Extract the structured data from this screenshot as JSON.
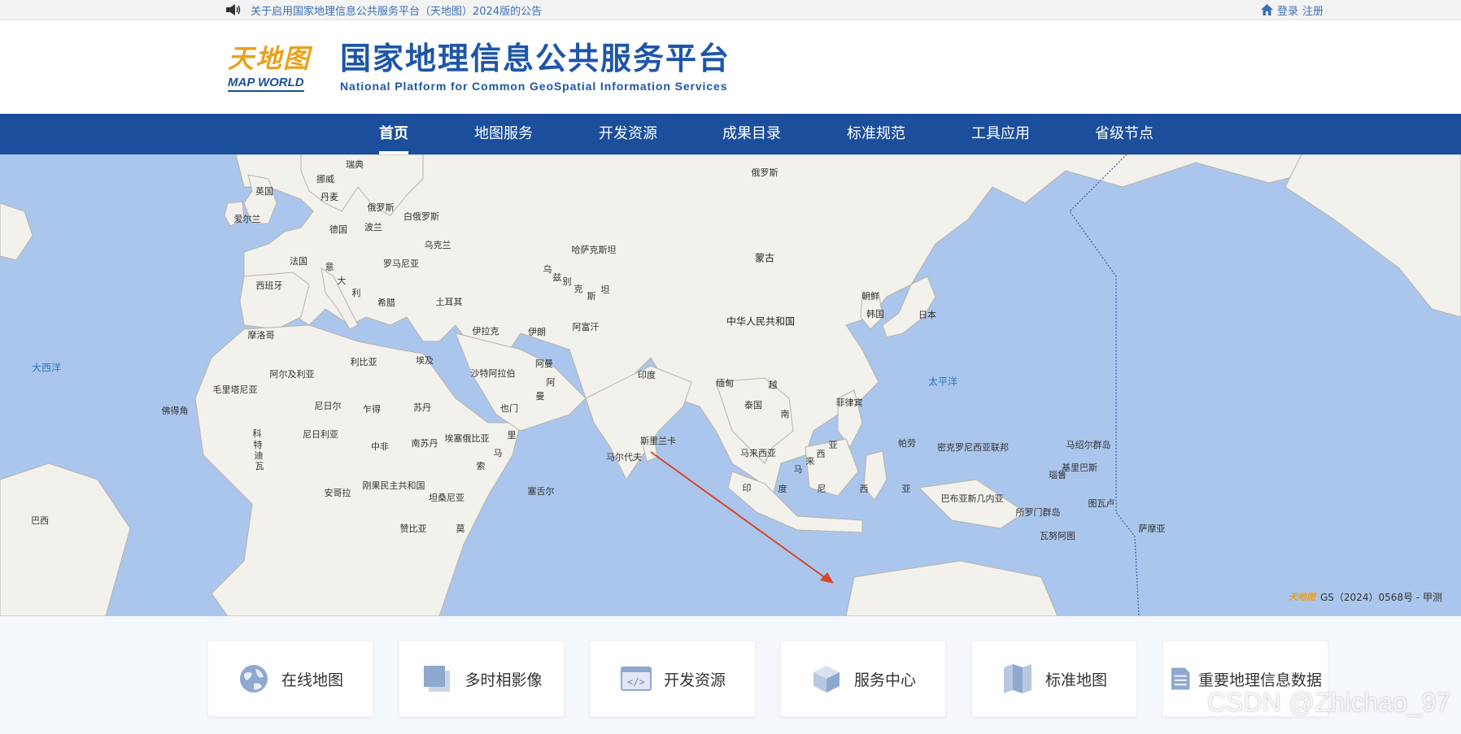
{
  "topbar": {
    "notice": "关于启用国家地理信息公共服务平台（天地图）2024版的公告",
    "login": "登录",
    "register": "注册"
  },
  "header": {
    "logo_cn": "天地图",
    "logo_en": "MAP WORLD",
    "title_cn": "国家地理信息公共服务平台",
    "title_en": "National Platform for Common GeoSpatial Information Services"
  },
  "nav": {
    "items": [
      {
        "label": "首页",
        "active": true
      },
      {
        "label": "地图服务"
      },
      {
        "label": "开发资源"
      },
      {
        "label": "成果目录"
      },
      {
        "label": "标准规范"
      },
      {
        "label": "工具应用"
      },
      {
        "label": "省级节点"
      }
    ]
  },
  "map": {
    "labels": {
      "sweden": "瑞典",
      "norway": "挪威",
      "uk": "英国",
      "denmark": "丹麦",
      "ireland": "爱尔兰",
      "russia_w": "俄罗斯",
      "belarus": "白俄罗斯",
      "germany": "德国",
      "poland": "波兰",
      "ukraine": "乌克兰",
      "france": "法国",
      "italy1": "意",
      "italy2": "大",
      "italy3": "利",
      "romania": "罗马尼亚",
      "spain": "西班牙",
      "greece": "希腊",
      "turkey": "土耳其",
      "russia": "俄罗斯",
      "kazakhstan": "哈萨克斯坦",
      "uzbek1": "乌",
      "uzbek2": "兹",
      "uzbek3": "别",
      "uzbek4": "克",
      "uzbek5": "斯",
      "uzbek6": "坦",
      "mongolia": "蒙古",
      "china": "中华人民共和国",
      "nkorea": "朝鲜",
      "skorea": "韩国",
      "japan": "日本",
      "morocco": "摩洛哥",
      "algeria": "阿尔及利亚",
      "libya": "利比亚",
      "egypt": "埃及",
      "iraq": "伊拉克",
      "iran": "伊朗",
      "afghanistan": "阿富汗",
      "saudi": "沙特阿拉伯",
      "oman1": "阿曼",
      "oman2": "阿",
      "oman3": "曼",
      "yemen": "也门",
      "india": "印度",
      "myanmar": "缅甸",
      "vietnam1": "越",
      "vietnam2": "南",
      "thailand": "泰国",
      "philippines": "菲律宾",
      "mauritania": "毛里塔尼亚",
      "mali": "马里",
      "niger": "尼日尔",
      "chad": "乍得",
      "sudan": "苏丹",
      "nigeria": "尼日利亚",
      "cotedivoire1": "科",
      "cotedivoire2": "特",
      "cotedivoire3": "迪",
      "cotedivoire4": "瓦",
      "car": "中非",
      "ssudan": "南苏丹",
      "ethiopia": "埃塞俄比亚",
      "somalia1": "索",
      "somalia2": "马",
      "somalia3": "里",
      "kenya": "肯尼亚",
      "drc": "刚果民主共和国",
      "tanzania": "坦桑尼亚",
      "angola": "安哥拉",
      "zambia": "赞比亚",
      "mozambique": "莫",
      "seychelles": "塞舌尔",
      "capeverde": "佛得角",
      "srilanka": "斯里兰卡",
      "maldives": "马尔代夫",
      "malaysia": "马来西亚",
      "indonesia1": "印",
      "indonesia2": "度",
      "indonesia3": "尼",
      "indonesia4": "西",
      "indonesia5": "亚",
      "indonesia_n1": "马",
      "indonesia_n2": "来",
      "indonesia_n3": "西",
      "indonesia_n4": "亚",
      "palau": "帕劳",
      "micronesia": "密克罗尼西亚联邦",
      "marshall": "马绍尔群岛",
      "kiribati": "基里巴斯",
      "nauru": "瑙鲁",
      "png": "巴布亚新几内亚",
      "solomon": "所罗门群岛",
      "tuvalu": "图瓦卢",
      "vanuatu": "瓦努阿图",
      "samoa": "萨摩亚",
      "brazil": "巴西",
      "atlantic": "大西洋",
      "pacific": "太平洋"
    },
    "copyright": "GS（2024）0568号 - 甲测"
  },
  "tiles": [
    {
      "label": "在线地图",
      "icon": "globe-icon"
    },
    {
      "label": "多时相影像",
      "icon": "layers-icon"
    },
    {
      "label": "开发资源",
      "icon": "code-window-icon"
    },
    {
      "label": "服务中心",
      "icon": "cube-icon"
    },
    {
      "label": "标准地图",
      "icon": "folded-map-icon"
    },
    {
      "label": "重要地理信息数据",
      "icon": "document-icon"
    }
  ],
  "watermark": "CSDN @Zhichao_97",
  "colors": {
    "nav_bg": "#1b4f9c",
    "title_blue": "#1e56a7",
    "logo_gold": "#e8a21c",
    "ocean": "#aac6ec",
    "land": "#f3f1ec",
    "arrow": "#d9452a"
  }
}
